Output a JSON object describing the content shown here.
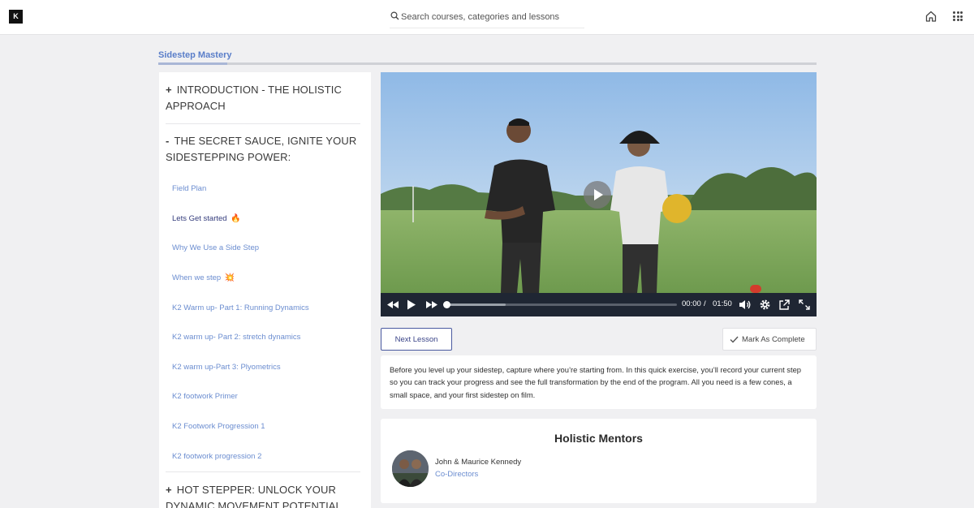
{
  "app": {
    "logo_text": "K"
  },
  "search": {
    "placeholder": "Search courses, categories and lessons"
  },
  "course": {
    "title": "Sidestep Mastery"
  },
  "sidebar": {
    "sections": [
      {
        "symbol": "+",
        "title": "INTRODUCTION - THE HOLISTIC APPROACH",
        "expanded": false
      },
      {
        "symbol": "-",
        "title": "THE SECRET SAUCE, IGNITE YOUR SIDESTEPPING POWER:",
        "expanded": true
      },
      {
        "symbol": "+",
        "title": "HOT STEPPER: UNLOCK YOUR DYNAMIC MOVEMENT POTENTIAL",
        "expanded": false
      }
    ],
    "lessons": [
      {
        "label": "Field Plan",
        "emoji": "",
        "active": false
      },
      {
        "label": "Lets Get started",
        "emoji": "🔥",
        "active": true
      },
      {
        "label": "Why We Use a Side Step",
        "emoji": "",
        "active": false
      },
      {
        "label": "When we step",
        "emoji": "💥",
        "active": false
      },
      {
        "label": "K2 Warm up- Part 1: Running Dynamics",
        "emoji": "",
        "active": false
      },
      {
        "label": "K2 warm up- Part 2: stretch dynamics",
        "emoji": "",
        "active": false
      },
      {
        "label": "K2 warm up-Part 3: Plyometrics",
        "emoji": "",
        "active": false
      },
      {
        "label": "K2 footwork Primer",
        "emoji": "",
        "active": false
      },
      {
        "label": "K2 Footwork Progression 1",
        "emoji": "",
        "active": false
      },
      {
        "label": "K2 footwork progression 2",
        "emoji": "",
        "active": false
      }
    ]
  },
  "player": {
    "current_time": "00:00",
    "separator": "/",
    "duration": "01:50",
    "progress_fraction": 0,
    "buffered_fraction": 0.26
  },
  "actions": {
    "next_label": "Next Lesson",
    "complete_label": "Mark As Complete"
  },
  "lesson": {
    "description": "Before you level up your sidestep, capture where you’re starting from. In this quick exercise, you’ll record your current step so you can track your progress and see the full transformation by the end of the program. All you need is a few cones, a small space, and your first sidestep on film."
  },
  "mentors": {
    "title": "Holistic Mentors",
    "name": "John & Maurice Kennedy",
    "role": "Co-Directors"
  },
  "icons": {
    "search": "search-icon",
    "home": "home-icon",
    "apps": "apps-grid-icon",
    "play": "play-icon",
    "rewind": "rewind-icon",
    "forward": "fast-forward-icon",
    "volume": "volume-icon",
    "settings": "gear-icon",
    "popout": "popout-icon",
    "fullscreen": "fullscreen-icon",
    "check": "check-icon"
  }
}
